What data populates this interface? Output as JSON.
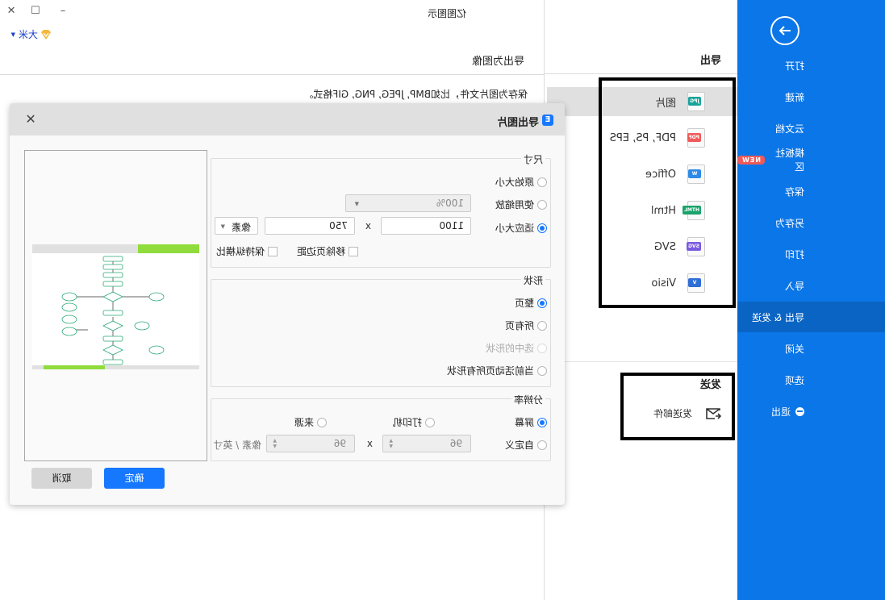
{
  "app_title": "亿图图示",
  "window_controls": {
    "minimize": "–",
    "maximize": "☐",
    "close": "✕"
  },
  "user": {
    "name": "大米",
    "icon": "vip-diamond-icon"
  },
  "sidebar": {
    "back_icon": "arrow-right-circle-icon",
    "items": [
      {
        "label": "打开"
      },
      {
        "label": "新建"
      },
      {
        "label": "云文档"
      },
      {
        "label": "模板社区",
        "badge": "NEW"
      },
      {
        "label": "保存"
      },
      {
        "label": "另存为"
      },
      {
        "label": "打印"
      },
      {
        "label": "导入"
      },
      {
        "label": "导出 & 发送",
        "active": true
      },
      {
        "label": "关闭"
      },
      {
        "label": "选项"
      },
      {
        "label": "退出",
        "icon": "exit-icon"
      }
    ],
    "color": "#0b76e8",
    "active_color": "#0a64c4"
  },
  "export_panel": {
    "title": "导出",
    "formats": [
      {
        "label": "图片",
        "tag": "JPG",
        "color": "#1aa39a",
        "active": true
      },
      {
        "label": "PDF, PS, EPS",
        "tag": "PDF",
        "color": "#f05a5a"
      },
      {
        "label": "Office",
        "tag": "W",
        "color": "#2e8ae6"
      },
      {
        "label": "Html",
        "tag": "HTML",
        "color": "#19a36a"
      },
      {
        "label": "SVG",
        "tag": "SVG",
        "color": "#7b5ce0"
      },
      {
        "label": "Visio",
        "tag": "V",
        "color": "#2f6fd6"
      }
    ],
    "send_title": "发送",
    "send_items": [
      {
        "label": "发送邮件",
        "icon": "mail-send-icon"
      }
    ]
  },
  "content": {
    "subtitle": "导出为图像",
    "description": "保存为图片文件，比如BMP, JPEG, PNG, GIF格式。"
  },
  "dialog": {
    "title": "导出图片",
    "logo": "E",
    "size_group": {
      "legend": "尺寸",
      "options": [
        {
          "label": "原始大小",
          "checked": false
        },
        {
          "label": "使用缩放",
          "checked": false
        },
        {
          "label": "适应大小",
          "checked": true
        }
      ],
      "zoom_value": "100%",
      "width": "1100",
      "height": "750",
      "times": "x",
      "unit": "像素",
      "remove_margin": {
        "label": "移除页边距",
        "checked": false
      },
      "keep_ratio": {
        "label": "保持纵横比",
        "checked": false
      }
    },
    "shape_group": {
      "legend": "形状",
      "options": [
        {
          "label": "整页",
          "checked": true,
          "disabled": false
        },
        {
          "label": "所有页",
          "checked": false,
          "disabled": false
        },
        {
          "label": "选中的形状",
          "checked": false,
          "disabled": true
        },
        {
          "label": "当前活动页所有形状",
          "checked": false,
          "disabled": false
        }
      ]
    },
    "resolution_group": {
      "legend": "分辨率",
      "options": [
        {
          "label": "屏幕",
          "checked": true
        },
        {
          "label": "打印机",
          "checked": false
        },
        {
          "label": "来源",
          "checked": false
        },
        {
          "label": "自定义",
          "checked": false
        }
      ],
      "dpi_x": "96",
      "dpi_y": "96",
      "times": "x",
      "unit": "像素 / 英寸"
    },
    "ok_label": "确定",
    "cancel_label": "取消",
    "close_icon": "close-icon"
  }
}
